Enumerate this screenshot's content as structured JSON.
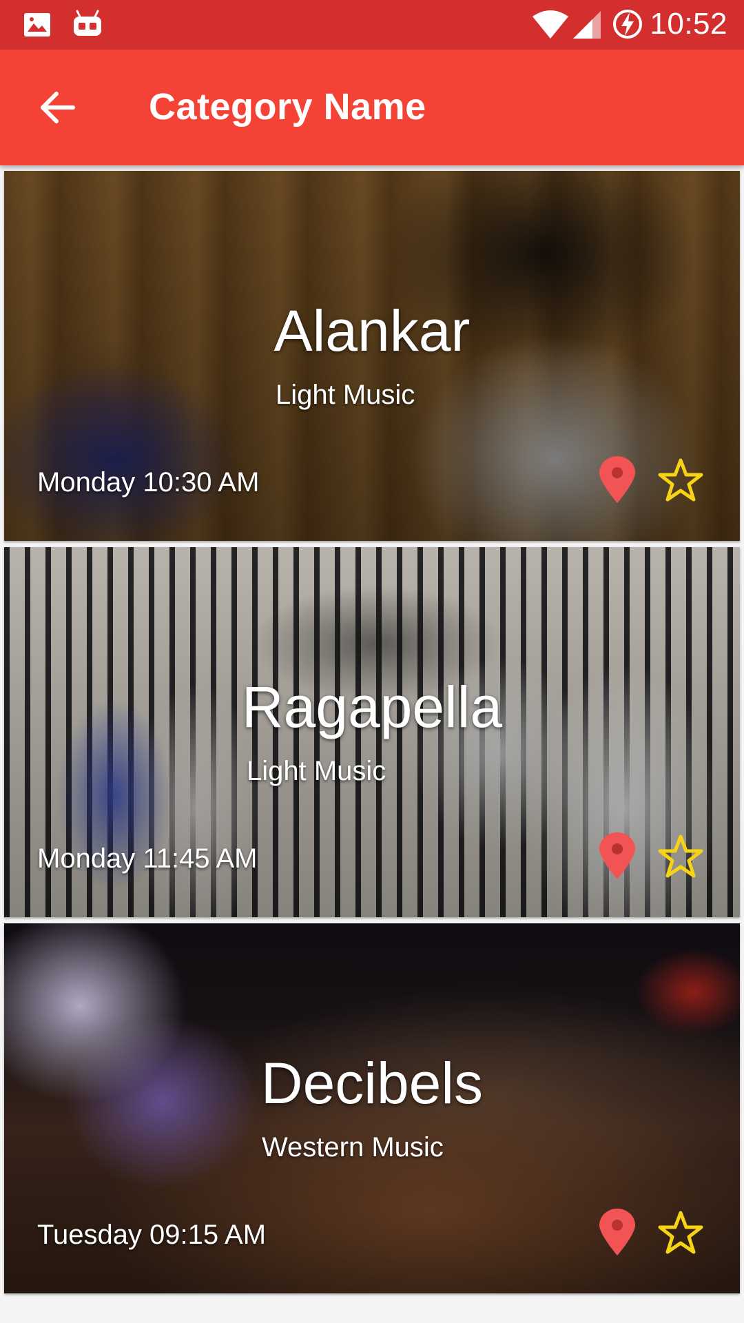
{
  "status_bar": {
    "time": "10:52",
    "icons": [
      "image-icon",
      "android-icon",
      "wifi-icon",
      "signal-icon",
      "battery-charging-icon"
    ]
  },
  "app_bar": {
    "back_icon": "arrow-left-icon",
    "title": "Category Name",
    "color": "#f44336",
    "status_color": "#d32f2f"
  },
  "events": [
    {
      "title": "Alankar",
      "category": "Light Music",
      "time": "Monday 10:30 AM",
      "location_icon": "map-pin-icon",
      "favorite_icon": "star-outline-icon"
    },
    {
      "title": "Ragapella",
      "category": "Light Music",
      "time": "Monday 11:45 AM",
      "location_icon": "map-pin-icon",
      "favorite_icon": "star-outline-icon"
    },
    {
      "title": "Decibels",
      "category": "Western Music",
      "time": "Tuesday 09:15 AM",
      "location_icon": "map-pin-icon",
      "favorite_icon": "star-outline-icon"
    }
  ],
  "colors": {
    "pin": "#f25454",
    "star": "#f7d315"
  }
}
